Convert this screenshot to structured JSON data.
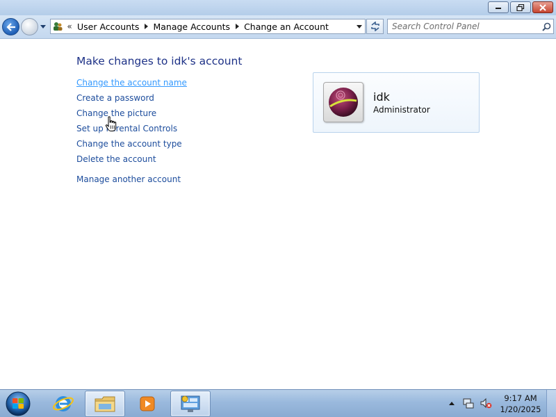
{
  "window": {
    "caption_buttons": [
      "minimize-icon",
      "restore-icon",
      "close-icon"
    ]
  },
  "nav": {
    "address_icon": "user-accounts-icon",
    "overflow": "«",
    "breadcrumbs": [
      "User Accounts",
      "Manage Accounts",
      "Change an Account"
    ],
    "search_placeholder": "Search Control Panel"
  },
  "main": {
    "heading": "Make changes to idk's account",
    "links": [
      "Change the account name",
      "Create a password",
      "Change the picture",
      "Set up Parental Controls",
      "Change the account type",
      "Delete the account",
      "Manage another account"
    ],
    "user": {
      "name": "idk",
      "role": "Administrator",
      "picture_icon": "ball-picture-icon"
    }
  },
  "taskbar": {
    "pinned": [
      "start-orb-icon",
      "internet-explorer-icon",
      "file-explorer-icon",
      "media-player-icon",
      "control-panel-icon"
    ],
    "clock_time": "9:17 AM",
    "clock_date": "1/20/2025"
  },
  "colors": {
    "link": "#1c4c9c",
    "link_hover": "#3399ff",
    "heading": "#1e3287",
    "taskbar": "#9ab9dd"
  }
}
